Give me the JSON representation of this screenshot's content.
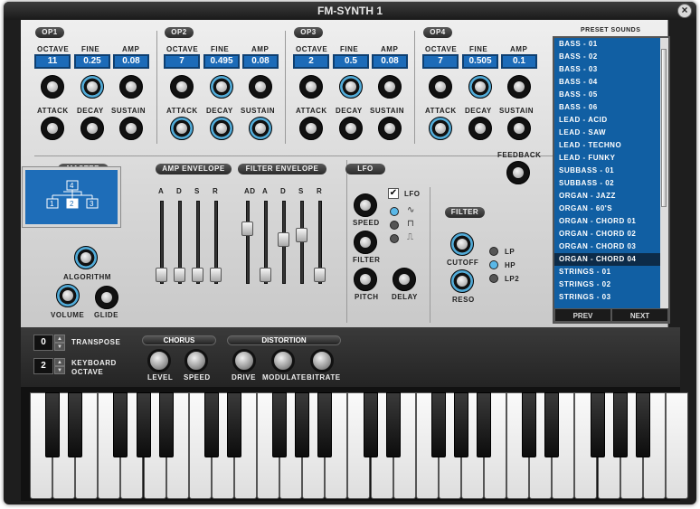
{
  "window": {
    "title": "FM-SYNTH 1",
    "close_icon": "close-icon"
  },
  "operators": [
    {
      "label": "OP1",
      "octave": "11",
      "fine": "0.25",
      "amp": "0.08"
    },
    {
      "label": "OP2",
      "octave": "7",
      "fine": "0.495",
      "amp": "0.08"
    },
    {
      "label": "OP3",
      "octave": "2",
      "fine": "0.5",
      "amp": "0.08"
    },
    {
      "label": "OP4",
      "octave": "7",
      "fine": "0.505",
      "amp": "0.1"
    }
  ],
  "op_labels": {
    "octave": "OCTAVE",
    "fine": "FINE",
    "amp": "AMP",
    "attack": "ATTACK",
    "decay": "DECAY",
    "sustain": "SUSTAIN"
  },
  "feedback": "FEEDBACK",
  "master": {
    "title": "MASTER",
    "algorithm": "ALGORITHM",
    "volume": "VOLUME",
    "glide": "GLIDE",
    "algo_nodes": [
      "4",
      "1",
      "2",
      "3"
    ]
  },
  "amp_envelope": {
    "title": "AMP ENVELOPE",
    "labels": [
      "A",
      "D",
      "S",
      "R"
    ]
  },
  "filter_envelope": {
    "title": "FILTER ENVELOPE",
    "labels": [
      "AD",
      "A",
      "D",
      "S",
      "R"
    ]
  },
  "lfo": {
    "title": "LFO",
    "toggle_label": "LFO",
    "checked": "✔",
    "speed": "SPEED",
    "filter": "FILTER",
    "pitch": "PITCH",
    "delay": "DELAY"
  },
  "filter": {
    "title": "FILTER",
    "cutoff": "CUTOFF",
    "reso": "RESO",
    "types": [
      "LP",
      "HP",
      "LP2"
    ],
    "selected": "HP"
  },
  "presets": {
    "title": "PRESET SOUNDS",
    "items": [
      "BASS - 01",
      "BASS - 02",
      "BASS - 03",
      "BASS - 04",
      "BASS - 05",
      "BASS - 06",
      "LEAD - ACID",
      "LEAD - SAW",
      "LEAD - TECHNO",
      "LEAD - FUNKY",
      "SUBBASS - 01",
      "SUBBASS - 02",
      "ORGAN - JAZZ",
      "ORGAN - 60'S",
      "ORGAN - CHORD 01",
      "ORGAN - CHORD 02",
      "ORGAN - CHORD 03",
      "ORGAN - CHORD 04",
      "STRINGS - 01",
      "STRINGS - 02",
      "STRINGS - 03"
    ],
    "selected": "ORGAN - CHORD 04",
    "prev": "PREV",
    "next": "NEXT"
  },
  "bottom": {
    "transpose": {
      "value": "0",
      "label": "TRANSPOSE"
    },
    "keyboard_octave": {
      "value": "2",
      "label1": "KEYBOARD",
      "label2": "OCTAVE"
    },
    "chorus": {
      "title": "CHORUS",
      "level": "LEVEL",
      "speed": "SPEED"
    },
    "distortion": {
      "title": "DISTORTION",
      "drive": "DRIVE",
      "modulate": "MODULATE",
      "bitrate": "BITRATE"
    }
  },
  "colors": {
    "accent": "#1c6bb8",
    "knob_ring": "#59b3df",
    "preset_bg": "#115fa3"
  }
}
